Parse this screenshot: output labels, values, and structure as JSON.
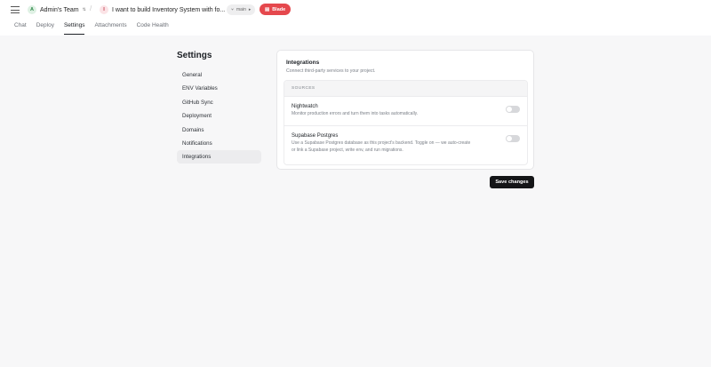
{
  "topbar": {
    "team_avatar": "A",
    "team_name": "Admin's Team",
    "separator": "/",
    "project_avatar": "I",
    "project_name": "I want to build Inventory System with fo...",
    "branch_label": "main",
    "blade_label": "Blade"
  },
  "tabs": [
    {
      "label": "Chat"
    },
    {
      "label": "Deploy"
    },
    {
      "label": "Settings"
    },
    {
      "label": "Attachments"
    },
    {
      "label": "Code Health"
    }
  ],
  "settings": {
    "title": "Settings",
    "nav": [
      {
        "label": "General"
      },
      {
        "label": "ENV Variables"
      },
      {
        "label": "GitHub Sync"
      },
      {
        "label": "Deployment"
      },
      {
        "label": "Domains"
      },
      {
        "label": "Notifications"
      },
      {
        "label": "Integrations"
      }
    ]
  },
  "integrations": {
    "title": "Integrations",
    "subtitle": "Connect third-party services to your project.",
    "sources_header": "SOURCES",
    "sources": [
      {
        "name": "Nightwatch",
        "description": "Monitor production errors and turn them into tasks automatically.",
        "enabled": false
      },
      {
        "name": "Supabase Postgres",
        "description_line1": "Use a Supabase Postgres database as this project's backend. Toggle on — we auto-create",
        "description_line2": "or link a Supabase project, write env, and run migrations.",
        "enabled": false
      }
    ]
  },
  "actions": {
    "save_label": "Save changes"
  },
  "colors": {
    "accent_red": "#e5484d",
    "primary_dark": "#141517",
    "background": "#f7f7f8"
  }
}
